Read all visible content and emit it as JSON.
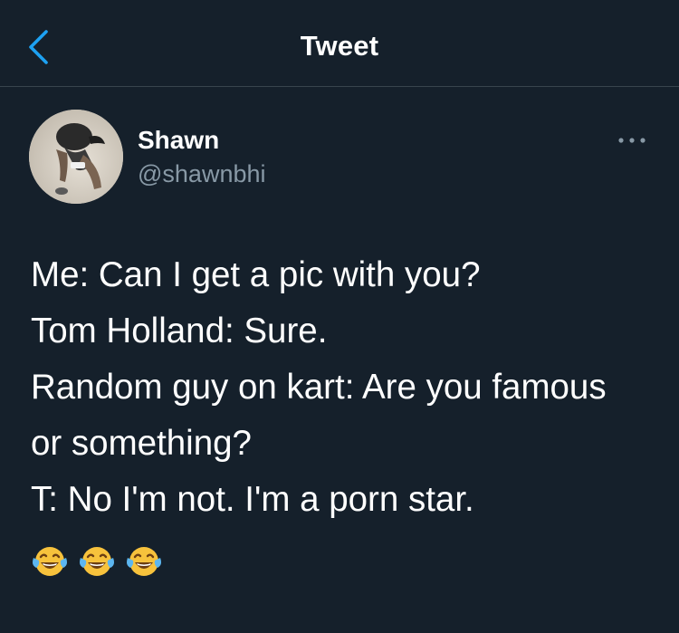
{
  "header": {
    "title": "Tweet",
    "back_icon": "chevron-left-icon"
  },
  "author": {
    "display_name": "Shawn",
    "handle": "@shawnbhi",
    "avatar": "avatar-photo"
  },
  "menu": {
    "icon": "more-horizontal-icon"
  },
  "tweet": {
    "lines": [
      "Me: Can I get a pic with you?",
      "Tom Holland: Sure.",
      "Random guy on kart: Are you famous",
      "or something?",
      "T: No I'm not. I'm a porn star."
    ],
    "emojis": [
      "face-with-tears-of-joy",
      "face-with-tears-of-joy",
      "face-with-tears-of-joy"
    ]
  },
  "colors": {
    "background": "#15202b",
    "accent": "#1da1f2",
    "secondary_text": "#8899a6",
    "divider": "#38444d"
  }
}
